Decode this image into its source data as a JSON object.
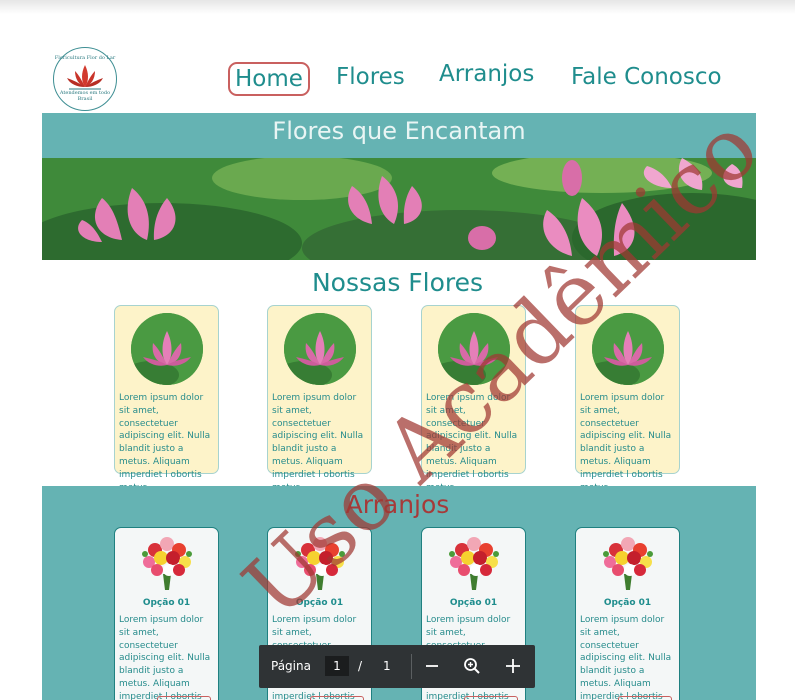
{
  "header": {
    "logo_text_top": "Floricultura Flor do Lar",
    "logo_text_bottom": "Atendemos em todo Brasil",
    "nav": [
      "Home",
      "Flores",
      "Arranjos",
      "Fale Conosco"
    ]
  },
  "hero": {
    "title": "Flores que Encantam",
    "image": "lotus-flowers-banner"
  },
  "flores": {
    "title": "Nossas Flores",
    "cards": [
      {
        "image": "lotus-flower",
        "text": "Lorem ipsum dolor sit amet, consectetuer adipiscing elit. Nulla blandit justo a metus. Aliquam imperdiet l obortis metus."
      },
      {
        "image": "lotus-flower",
        "text": "Lorem ipsum dolor sit amet, consectetuer adipiscing elit. Nulla blandit justo a metus. Aliquam imperdiet l obortis metus."
      },
      {
        "image": "lotus-flower",
        "text": "Lorem ipsum dolor sit amet, consectetuer adipiscing elit. Nulla blandit justo a metus. Aliquam imperdiet l obortis metus."
      },
      {
        "image": "lotus-flower",
        "text": "Lorem ipsum dolor sit amet, consectetuer adipiscing elit. Nulla blandit justo a metus. Aliquam imperdiet l obortis metus."
      }
    ]
  },
  "arranjos": {
    "title": "Arranjos",
    "cards": [
      {
        "image": "flower-bouquet",
        "title": "Opção 01",
        "text": "Lorem ipsum dolor sit amet, consectetuer adipiscing elit. Nulla blandit justo a metus. Aliquam imperdiet l obortis metus."
      },
      {
        "image": "flower-bouquet",
        "title": "Opção 01",
        "text": "Lorem ipsum dolor sit amet, consectetuer adipiscing elit. Nulla blandit justo a metus. Aliquam imperdiet l obortis metus."
      },
      {
        "image": "flower-bouquet",
        "title": "Opção 01",
        "text": "Lorem ipsum dolor sit amet, consectetuer adipiscing elit. Nulla blandit justo a metus. Aliquam imperdiet l obortis metus."
      },
      {
        "image": "flower-bouquet",
        "title": "Opção 01",
        "text": "Lorem ipsum dolor sit amet, consectetuer adipiscing elit. Nulla blandit justo a metus. Aliquam imperdiet l obortis metus."
      }
    ]
  },
  "watermark": "Uso Acadêmico",
  "pdf_toolbar": {
    "page_label": "Página",
    "current_page": "1",
    "separator": "/",
    "total_pages": "1",
    "zoom_out_icon": "minus-icon",
    "zoom_reset_icon": "zoom-icon",
    "zoom_in_icon": "plus-icon"
  },
  "colors": {
    "teal": "#1f8d8d",
    "band": "#65b3b3",
    "accent_red": "#c9605f",
    "card_cream": "#fdf3c9"
  }
}
